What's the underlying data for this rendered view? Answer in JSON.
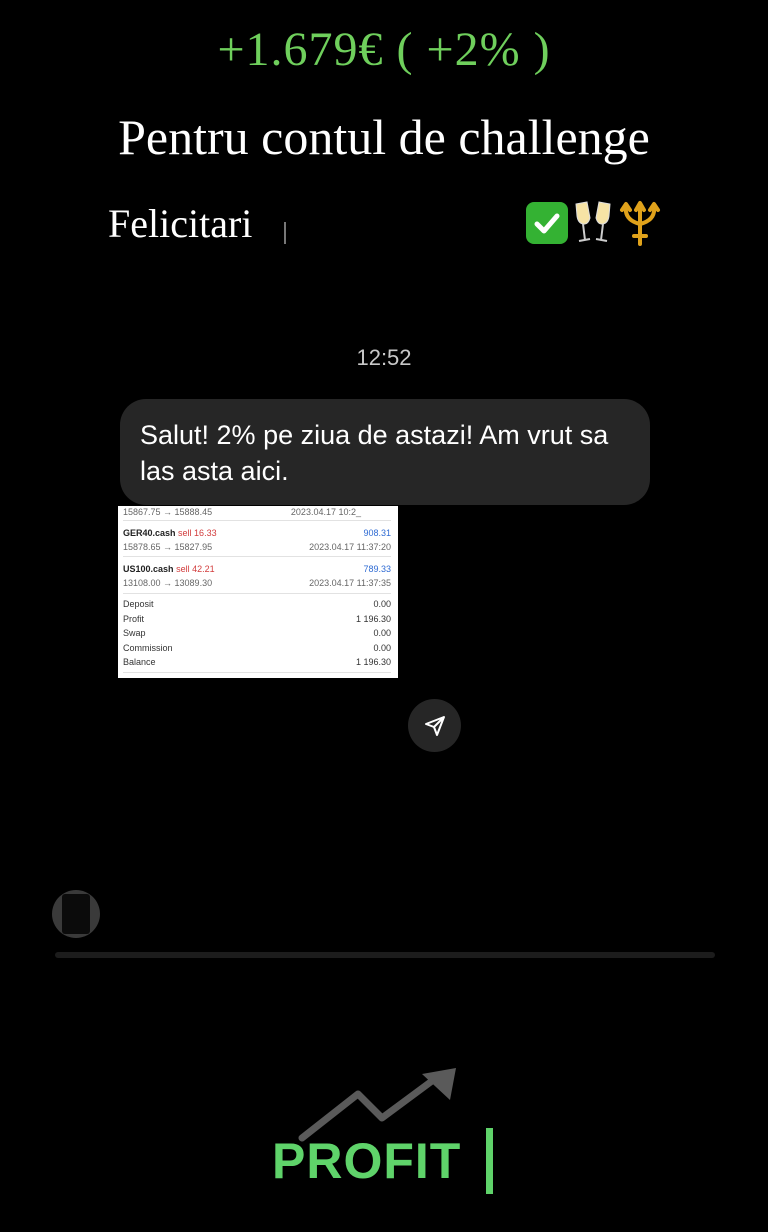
{
  "header": {
    "amount": "+1.679€ ( +2% )",
    "subtitle": "Pentru contul de challenge",
    "congrats": "Felicitari"
  },
  "emojis": [
    "check-mark-icon",
    "clinking-glasses-icon",
    "trident-icon"
  ],
  "chat": {
    "time": "12:52",
    "message": "Salut! 2% pe ziua de astazi! Am vrut sa las asta aici."
  },
  "trade_screenshot": {
    "partial_row": {
      "prices": "15867.75 → 15888.45",
      "time": "2023.04.17 10:2_"
    },
    "trades": [
      {
        "symbol": "GER40.cash",
        "side": "sell 16.33",
        "profit": "908.31",
        "prices": "15878.65 → 15827.95",
        "time": "2023.04.17 11:37:20"
      },
      {
        "symbol": "US100.cash",
        "side": "sell 42.21",
        "profit": "789.33",
        "prices": "13108.00 → 13089.30",
        "time": "2023.04.17 11:37:35"
      }
    ],
    "summary": [
      {
        "label": "Deposit",
        "value": "0.00"
      },
      {
        "label": "Profit",
        "value": "1 196.30"
      },
      {
        "label": "Swap",
        "value": "0.00"
      },
      {
        "label": "Commission",
        "value": "0.00"
      },
      {
        "label": "Balance",
        "value": "1 196.30"
      }
    ]
  },
  "footer": {
    "logo_text": "PROFIT"
  },
  "colors": {
    "headline": "#6fcf5c",
    "bubble": "#262626",
    "background": "#000000",
    "profit_logo": "#5fd36a"
  }
}
